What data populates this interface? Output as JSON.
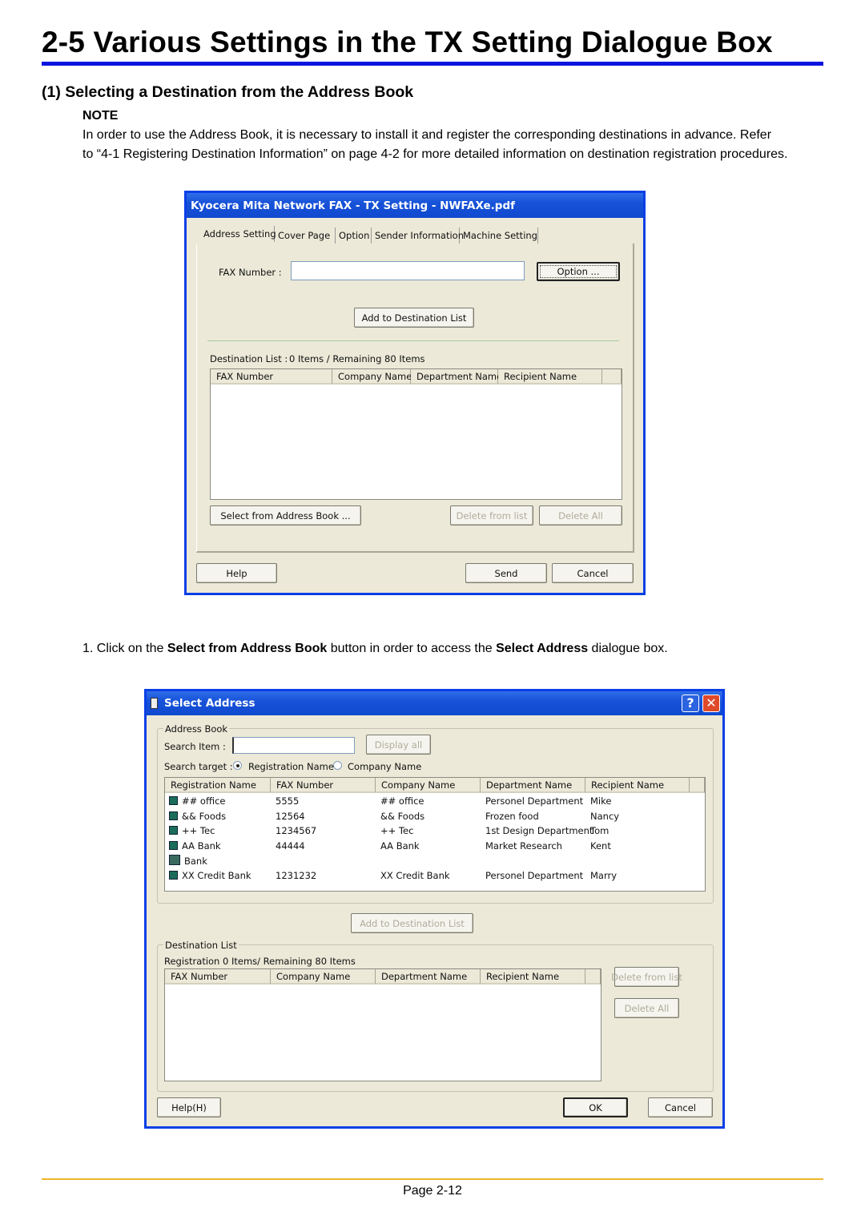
{
  "heading": "2-5  Various Settings in the TX Setting Dialogue Box",
  "subheading": "(1) Selecting a Destination from the Address Book",
  "note_label": "NOTE",
  "note_lines": [
    "In order to use the Address Book, it is necessary to install it and register the corresponding destinations in advance. Refer",
    "to “4-1 Registering Destination Information” on page 4-2 for more detailed information on destination registration procedures."
  ],
  "step1": {
    "prefix": "1. Click on the ",
    "b1": "Select from Address Book",
    "mid": " button in order to access the ",
    "b2": "Select Address",
    "suffix": " dialogue box."
  },
  "tx_dialog": {
    "title": "Kyocera Mita Network FAX - TX Setting - NWFAXe.pdf",
    "tabs": [
      "Address Setting",
      "Cover Page",
      "Option",
      "Sender Information",
      "Machine Setting"
    ],
    "fax_label": "FAX Number :",
    "fax_value": "",
    "option_button": "Option ...",
    "add_button": "Add to Destination List",
    "dest_label": "Destination List :",
    "dest_count": "0 Items / Remaining 80 Items",
    "columns": [
      "FAX Number",
      "Company Name",
      "Department Name",
      "Recipient Name"
    ],
    "select_button": "Select from Address Book ...",
    "delete_button": "Delete from list",
    "delete_all_button": "Delete All",
    "help_button": "Help",
    "send_button": "Send",
    "cancel_button": "Cancel"
  },
  "select_dialog": {
    "title": "Select Address",
    "address_book_label": "Address Book",
    "search_label": "Search Item  :",
    "search_value": "",
    "display_all": "Display all",
    "search_target_label": "Search target :",
    "radio_options": [
      "Registration Name",
      "Company Name"
    ],
    "radio_selected": "Registration Name",
    "columns": [
      "Registration Name",
      "FAX Number",
      "Company Name",
      "Department Name",
      "Recipient Name"
    ],
    "rows": [
      {
        "icon": "contact-icon",
        "name": "## office",
        "fax": "5555",
        "company": "## office",
        "dept": "Personel Department",
        "recipient": "Mike"
      },
      {
        "icon": "contact-icon",
        "name": "&& Foods",
        "fax": "12564",
        "company": "&& Foods",
        "dept": "Frozen food",
        "recipient": "Nancy"
      },
      {
        "icon": "contact-icon",
        "name": "++ Tec",
        "fax": "1234567",
        "company": "++ Tec",
        "dept": "1st Design Department",
        "recipient": "Tom"
      },
      {
        "icon": "contact-icon",
        "name": "AA Bank",
        "fax": "44444",
        "company": "AA Bank",
        "dept": "Market Research",
        "recipient": "Kent"
      },
      {
        "icon": "group-icon",
        "name": "Bank",
        "fax": "",
        "company": "",
        "dept": "",
        "recipient": ""
      },
      {
        "icon": "contact-icon",
        "name": "XX Credit Bank",
        "fax": "1231232",
        "company": "XX Credit Bank",
        "dept": "Personel Department",
        "recipient": "Marry"
      }
    ],
    "add_button": "Add to Destination List",
    "dest_group_label": "Destination List",
    "dest_count": "Registration 0 Items/ Remaining 80 Items",
    "dest_columns": [
      "FAX Number",
      "Company Name",
      "Department Name",
      "Recipient Name"
    ],
    "delete_button": "Delete from list",
    "delete_all_button": "Delete All",
    "help_button": "Help(H)",
    "ok_button": "OK",
    "cancel_button": "Cancel"
  },
  "footer": {
    "page": "Page 2-12"
  },
  "colors": {
    "rule": "#0a14e0",
    "footer_rule": "#f0b428",
    "dialog_border": "#0a3fe6",
    "dialog_bg": "#ece9d8"
  }
}
